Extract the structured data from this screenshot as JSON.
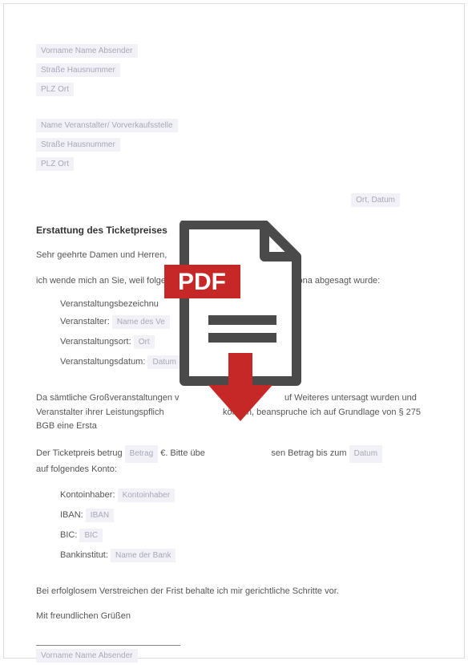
{
  "sender": {
    "name": "Vorname Name Absender",
    "street": "Straße Hausnummer",
    "city": "PLZ Ort"
  },
  "recipient": {
    "name": "Name Veranstalter/ Vorverkaufsstelle",
    "street": "Straße Hausnummer",
    "city": "PLZ Ort"
  },
  "place_date": "Ort, Datum",
  "subject": "Erstattung des Ticketpreises",
  "salutation": "Sehr geehrte Damen und Herren,",
  "intro_pre": "ich wende mich an Sie, weil folgende",
  "intro_post": "n Corona abgesagt wurde:",
  "event": {
    "label_name": "Veranstaltungsbezeichnu",
    "label_organizer": "Veranstalter:",
    "organizer_value": "Name des Ve",
    "label_place": "Veranstaltungsort:",
    "place_value": "Ort",
    "label_date": "Veranstaltungsdatum:",
    "date_value": "Datum"
  },
  "body1_a": "Da sämtliche Großveranstaltungen v",
  "body1_b": "uf Weiteres untersagt wurden und Veranstalter ihrer Leistungspflich",
  "body1_c": "können, beanspruche ich auf Grundlage von § 275 BGB eine Ersta",
  "price_line_a": "Der Ticketpreis betrug",
  "price_value": "Betrag",
  "price_line_b": "€. Bitte übe",
  "price_line_c": "sen Betrag bis zum",
  "price_date": "Datum",
  "price_line_d": "auf folgendes Konto:",
  "bank": {
    "label_holder": "Kontoinhaber:",
    "holder": "Kontoinhaber",
    "label_iban": "IBAN:",
    "iban": "IBAN",
    "label_bic": "BIC:",
    "bic": "BIC",
    "label_bank": "Bankinstitut:",
    "bank": "Name der Bank"
  },
  "closing1": "Bei erfolglosem Verstreichen der Frist behalte ich mir gerichtliche Schritte vor.",
  "closing2": "Mit freundlichen Grüßen",
  "signature": "Vorname Name Absender",
  "pdf_badge": "PDF"
}
